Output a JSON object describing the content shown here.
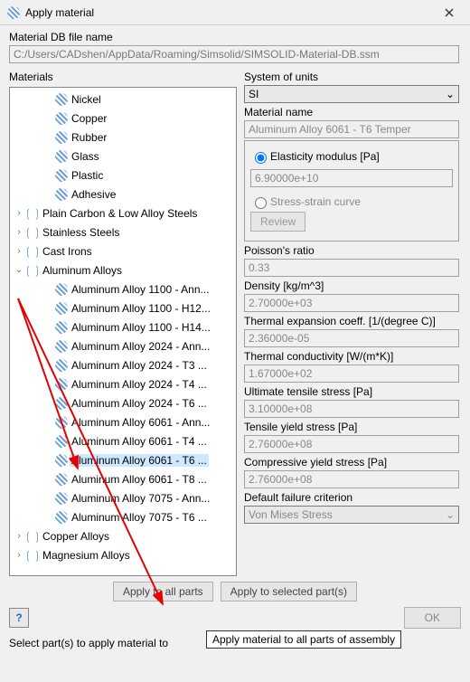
{
  "window": {
    "title": "Apply material"
  },
  "path": {
    "label": "Material DB file name",
    "value": "C:/Users/CADshen/AppData/Roaming/Simsolid/SIMSOLID-Material-DB.ssm"
  },
  "materials_label": "Materials",
  "tree": {
    "top_items": [
      "Nickel",
      "Copper",
      "Rubber",
      "Glass",
      "Plastic",
      "Adhesive"
    ],
    "groups_top": [
      "Plain Carbon & Low Alloy Steels",
      "Stainless Steels",
      "Cast Irons"
    ],
    "al_group": "Aluminum Alloys",
    "al_children": [
      "Aluminum Alloy 1100 - Ann...",
      "Aluminum Alloy 1100 - H12...",
      "Aluminum Alloy 1100 - H14...",
      "Aluminum Alloy 2024 - Ann...",
      "Aluminum Alloy 2024 - T3 ...",
      "Aluminum Alloy 2024 - T4 ...",
      "Aluminum Alloy 2024 - T6 ...",
      "Aluminum Alloy 6061 - Ann...",
      "Aluminum Alloy 6061 - T4 ...",
      "Aluminum Alloy 6061 - T6 ...",
      "Aluminum Alloy 6061 - T8 ...",
      "Aluminum Alloy 7075 - Ann...",
      "Aluminum Alloy 7075 - T6 ..."
    ],
    "selected_index": 9,
    "groups_bottom": [
      "Copper Alloys",
      "Magnesium Alloys"
    ]
  },
  "units": {
    "label": "System of units",
    "value": "SI"
  },
  "material": {
    "label": "Material name",
    "value": "Aluminum Alloy 6061 - T6 Temper"
  },
  "prop": {
    "elasticity_label": "Elasticity modulus [Pa]",
    "elasticity_value": "6.90000e+10",
    "stress_curve_label": "Stress-strain curve",
    "review_btn": "Review"
  },
  "fields": {
    "poisson_label": "Poisson's ratio",
    "poisson_value": "0.33",
    "density_label": "Density [kg/m^3]",
    "density_value": "2.70000e+03",
    "thermexp_label": "Thermal expansion coeff. [1/(degree C)]",
    "thermexp_value": "2.36000e-05",
    "thermcond_label": "Thermal conductivity [W/(m*K)]",
    "thermcond_value": "1.67000e+02",
    "uts_label": "Ultimate tensile stress [Pa]",
    "uts_value": "3.10000e+08",
    "tys_label": "Tensile yield stress [Pa]",
    "tys_value": "2.76000e+08",
    "cys_label": "Compressive yield stress [Pa]",
    "cys_value": "2.76000e+08",
    "failure_label": "Default failure criterion",
    "failure_value": "Von Mises Stress"
  },
  "buttons": {
    "apply_all": "Apply to all parts",
    "apply_sel": "Apply to selected part(s)",
    "ok": "OK"
  },
  "tooltip": "Apply material to all parts of assembly",
  "status": "Select part(s) to apply material to"
}
